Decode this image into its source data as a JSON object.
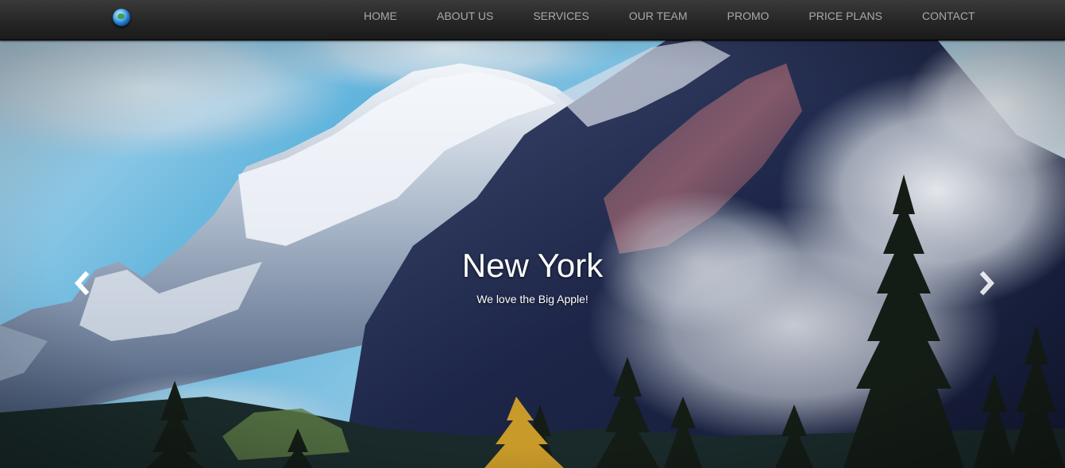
{
  "navbar": {
    "logo_icon": "globe-icon",
    "menu": [
      {
        "label": "HOME"
      },
      {
        "label": "ABOUT US"
      },
      {
        "label": "SERVICES"
      },
      {
        "label": "OUR TEAM"
      },
      {
        "label": "PROMO"
      },
      {
        "label": "PRICE PLANS"
      },
      {
        "label": "CONTACT"
      }
    ]
  },
  "carousel": {
    "slide": {
      "title": "New York",
      "text": "We love the Big Apple!"
    },
    "prev_icon": "chevron-left-icon",
    "next_icon": "chevron-right-icon"
  },
  "colors": {
    "navbar_bg": "#262626",
    "nav_text": "#a9a9a9",
    "caption_text": "#ffffff"
  }
}
